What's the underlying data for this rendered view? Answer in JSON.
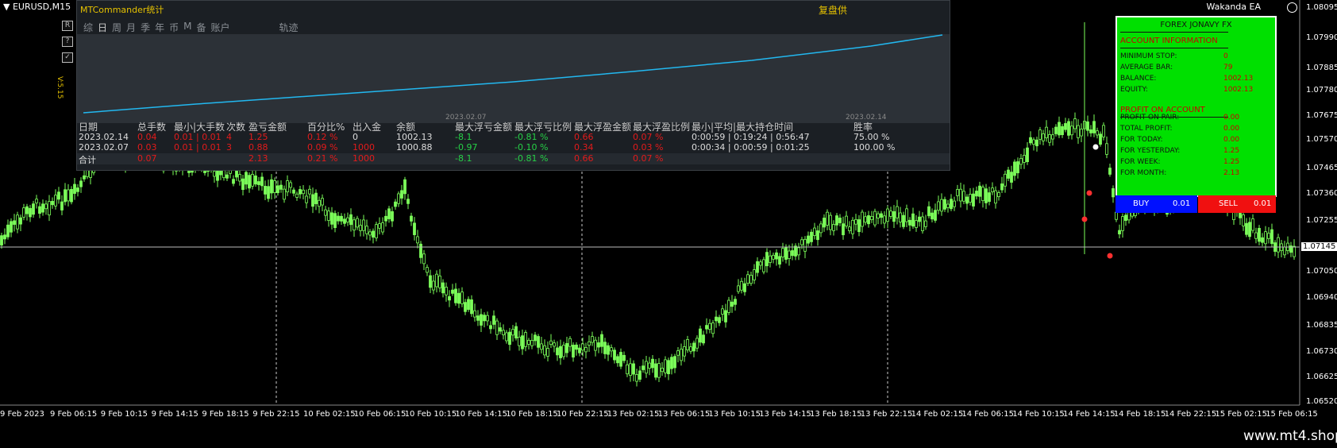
{
  "chart": {
    "symbol": "EURUSD,M15",
    "ea_name": "Wakanda EA",
    "current_price": "1.07145",
    "price_labels": [
      "1.08095",
      "1.07990",
      "1.07885",
      "1.07780",
      "1.07675",
      "1.07570",
      "1.07465",
      "1.07360",
      "1.07255",
      "1.07050",
      "1.06940",
      "1.06835",
      "1.06730",
      "1.06625",
      "1.06520"
    ],
    "time_labels": [
      "9 Feb 2023",
      "9 Feb 06:15",
      "9 Feb 10:15",
      "9 Feb 14:15",
      "9 Feb 18:15",
      "9 Feb 22:15",
      "10 Feb 02:15",
      "10 Feb 06:15",
      "10 Feb 10:15",
      "10 Feb 14:15",
      "10 Feb 18:15",
      "10 Feb 22:15",
      "13 Feb 02:15",
      "13 Feb 06:15",
      "13 Feb 10:15",
      "13 Feb 14:15",
      "13 Feb 18:15",
      "13 Feb 22:15",
      "14 Feb 02:15",
      "14 Feb 06:15",
      "14 Feb 10:15",
      "14 Feb 14:15",
      "14 Feb 18:15",
      "14 Feb 22:15",
      "15 Feb 02:15",
      "15 Feb 06:15"
    ],
    "colors": {
      "candle": "#7cff5a",
      "background": "#000000",
      "separator": "#ffffff"
    }
  },
  "side_buttons": [
    "R",
    "?",
    "✓"
  ],
  "version": "V:5.15",
  "commander": {
    "title": "MTCommander统计",
    "replay": "复盘供",
    "tabs": [
      "综",
      "日",
      "周",
      "月",
      "季",
      "年",
      "币",
      "M",
      "备",
      "账户",
      "轨迹"
    ],
    "active_tab": "日",
    "graph_dates": [
      "2023.02.07",
      "2023.02.14"
    ],
    "headers": [
      "日期",
      "总手数",
      "最小|大手数",
      "次数",
      "盈亏金额",
      "百分比%",
      "出入金",
      "余额",
      "最大浮亏金额",
      "最大浮亏比例",
      "最大浮盈金额",
      "最大浮盈比例",
      "最小|平均|最大持仓时间",
      "胜率"
    ],
    "rows": [
      [
        "2023.02.14",
        "0.04",
        "0.01 | 0.01",
        "4",
        "1.25",
        "0.12 %",
        "0",
        "1002.13",
        "-8.1",
        "-0.81 %",
        "0.66",
        "0.07 %",
        "0:00:59 | 0:19:24 | 0:56:47",
        "75.00 %"
      ],
      [
        "2023.02.07",
        "0.03",
        "0.01 | 0.01",
        "3",
        "0.88",
        "0.09 %",
        "1000",
        "1000.88",
        "-0.97",
        "-0.10 %",
        "0.34",
        "0.03 %",
        "0:00:34 | 0:00:59 | 0:01:25",
        "100.00 %"
      ]
    ],
    "total": [
      "合计",
      "0.07",
      "",
      "",
      "2.13",
      "0.21 %",
      "1000",
      "",
      "-8.1",
      "-0.81 %",
      "0.66",
      "0.07 %",
      "",
      ""
    ],
    "line_color": "#22b8f0"
  },
  "info_panel": {
    "title": "FOREX JONAVY FX",
    "account_section": "ACCOUNT INFORMATION",
    "account": [
      {
        "label": "MINIMUM STOP:",
        "value": "0"
      },
      {
        "label": "AVERAGE BAR:",
        "value": "79"
      },
      {
        "label": "BALANCE:",
        "value": "1002.13"
      },
      {
        "label": "EQUITY:",
        "value": "1002.13"
      }
    ],
    "profit_section": "PROFIT ON ACCOUNT",
    "profit": [
      {
        "label": "PROFIT ON PAIR:",
        "value": "0.00"
      },
      {
        "label": "TOTAL PROFIT:",
        "value": "0.00"
      },
      {
        "label": "FOR TODAY:",
        "value": "0.00"
      },
      {
        "label": "FOR YESTERDAY:",
        "value": "1.25"
      },
      {
        "label": "FOR WEEK:",
        "value": "1.25"
      },
      {
        "label": "FOR MONTH:",
        "value": "2.13"
      }
    ],
    "buy_label": "BUY",
    "buy_lot": "0.01",
    "sell_label": "SELL",
    "sell_lot": "0.01"
  },
  "watermark": "www.mt4.shop"
}
